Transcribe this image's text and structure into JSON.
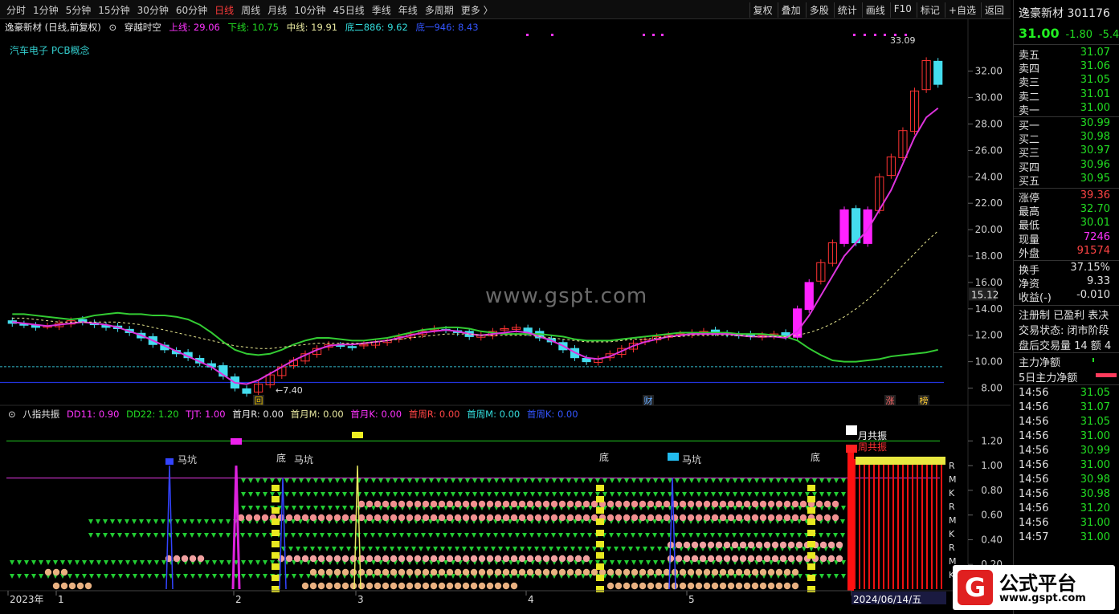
{
  "toolbar": {
    "timeframes": [
      "分时",
      "1分钟",
      "5分钟",
      "15分钟",
      "30分钟",
      "60分钟",
      "日线",
      "周线",
      "月线",
      "10分钟",
      "45日线",
      "季线",
      "年线",
      "多周期",
      "更多 〉"
    ],
    "active_timeframe": "日线",
    "tools": [
      "复权",
      "叠加",
      "多股",
      "统计",
      "画线",
      "F10",
      "标记",
      "+自选",
      "返回"
    ]
  },
  "main_info": {
    "title": "逸豪新材 (日线,前复权)",
    "indicator": "穿越时空",
    "upper": "上线: 29.06",
    "lower": "下线: 10.75",
    "middle": "中线: 19.91",
    "bottom2": "底二886: 9.62",
    "bottom3": "底一946: 8.43"
  },
  "sector": "汽车电子 PCB概念",
  "watermark": "www.gspt.com",
  "price_axis": [
    "32.00",
    "30.00",
    "28.00",
    "26.00",
    "24.00",
    "22.00",
    "20.00",
    "18.00",
    "16.00",
    "14.00",
    "12.00",
    "10.00",
    "8.00"
  ],
  "price_marker": "15.12",
  "annotations": {
    "high": "33.09",
    "low": "←7.40",
    "marks": [
      "回",
      "财",
      "涨",
      "榜"
    ]
  },
  "sub_info": {
    "name": "八指共振",
    "dd11": "DD11: 0.90",
    "dd22": "DD22: 1.20",
    "tjt": "TJT: 1.00",
    "first_month_r": "首月R: 0.00",
    "first_month_m": "首月M: 0.00",
    "first_month_k": "首月K: 0.00",
    "first_week_r": "首周R: 0.00",
    "first_week_m": "首周M: 0.00",
    "first_week_k": "首周K: 0.00"
  },
  "sub_axis": [
    "1.20",
    "1.00",
    "0.80",
    "0.60",
    "0.40",
    "0.20"
  ],
  "sub_labels": [
    "马坑",
    "底",
    "马坑",
    "底",
    "马坑",
    "底",
    "月共振",
    "周共振"
  ],
  "row_labels": [
    "R",
    "M",
    "K",
    "R",
    "M",
    "K",
    "R",
    "M",
    "K"
  ],
  "x_axis": [
    "2023年",
    "1",
    "2",
    "3",
    "4",
    "5",
    "2024/06/14/五"
  ],
  "side": {
    "name": "逸豪新材",
    "code": "301176",
    "price": "31.00",
    "change": "-1.80",
    "pct": "-5.4",
    "asks": [
      {
        "k": "卖五",
        "v": "31.07"
      },
      {
        "k": "卖四",
        "v": "31.06"
      },
      {
        "k": "卖三",
        "v": "31.05"
      },
      {
        "k": "卖二",
        "v": "31.01"
      },
      {
        "k": "卖一",
        "v": "31.00"
      }
    ],
    "bids": [
      {
        "k": "买一",
        "v": "30.99"
      },
      {
        "k": "买二",
        "v": "30.98"
      },
      {
        "k": "买三",
        "v": "30.97"
      },
      {
        "k": "买四",
        "v": "30.96"
      },
      {
        "k": "买五",
        "v": "30.95"
      }
    ],
    "stats1": [
      {
        "k": "涨停",
        "v": "39.36",
        "c": "#ff4444"
      },
      {
        "k": "最高",
        "v": "32.70",
        "c": "#22dd22"
      },
      {
        "k": "最低",
        "v": "30.01",
        "c": "#22dd22"
      },
      {
        "k": "现量",
        "v": "7246",
        "c": "#ff33ff"
      },
      {
        "k": "外盘",
        "v": "91574",
        "c": "#ff4444"
      }
    ],
    "stats2": [
      {
        "k": "换手",
        "v": "37.15%",
        "c": "#e0e0e0"
      },
      {
        "k": "净资",
        "v": "9.33",
        "c": "#e0e0e0"
      },
      {
        "k": "收益(-)",
        "v": "-0.010",
        "c": "#e0e0e0"
      }
    ],
    "status": [
      "注册制 已盈利 表决",
      "交易状态: 闭市阶段",
      "盘后交易量 14 额 4"
    ],
    "flow": [
      "主力净额",
      "5日主力净额"
    ],
    "ticks": [
      {
        "t": "14:56",
        "v": "31.05"
      },
      {
        "t": "14:56",
        "v": "31.07"
      },
      {
        "t": "14:56",
        "v": "31.05"
      },
      {
        "t": "14:56",
        "v": "31.00"
      },
      {
        "t": "14:56",
        "v": "30.99"
      },
      {
        "t": "14:56",
        "v": "31.00"
      },
      {
        "t": "14:56",
        "v": "30.98"
      },
      {
        "t": "14:56",
        "v": "30.98"
      },
      {
        "t": "14:56",
        "v": "31.20"
      },
      {
        "t": "14:56",
        "v": "31.00"
      },
      {
        "t": "14:57",
        "v": "31.00"
      }
    ]
  },
  "logo": {
    "text": "公式平台",
    "url": "www.gspt.com"
  },
  "chart_data": {
    "type": "line",
    "title": "逸豪新材 (日线,前复权)",
    "ylim": [
      7,
      33.5
    ],
    "y_ticks": [
      8,
      10,
      12,
      14,
      16,
      18,
      20,
      22,
      24,
      26,
      28,
      30,
      32
    ],
    "x_tick_labels": [
      "2023年",
      "1",
      "2",
      "3",
      "4",
      "5",
      "2024/06/14/五"
    ],
    "close": [
      12.9,
      12.8,
      12.6,
      12.7,
      12.9,
      13.1,
      13.0,
      12.8,
      12.6,
      12.5,
      12.2,
      11.8,
      11.3,
      10.9,
      10.6,
      10.3,
      9.9,
      9.6,
      8.9,
      8.0,
      7.6,
      8.3,
      9.0,
      9.6,
      10.1,
      10.6,
      11.0,
      11.3,
      11.2,
      11.1,
      11.3,
      11.5,
      11.6,
      11.9,
      12.1,
      12.3,
      12.5,
      12.4,
      12.2,
      11.9,
      12.0,
      12.3,
      12.5,
      12.6,
      12.2,
      11.8,
      11.5,
      10.9,
      10.3,
      10.0,
      10.2,
      10.6,
      11.0,
      11.4,
      11.7,
      11.9,
      12.0,
      12.1,
      12.2,
      12.3,
      12.2,
      12.1,
      12.0,
      11.9,
      12.0,
      12.1,
      11.9,
      14.0,
      16.0,
      17.5,
      19.0,
      21.5,
      19.0,
      21.5,
      24.0,
      25.5,
      27.5,
      30.5,
      32.8,
      31.0
    ],
    "series": [
      {
        "name": "上线",
        "values": [
          13.6,
          13.6,
          13.5,
          13.4,
          13.3,
          13.2,
          13.3,
          13.5,
          13.6,
          13.7,
          13.6,
          13.6,
          13.5,
          13.5,
          13.4,
          13.2,
          12.8,
          12.2,
          11.5,
          10.9,
          10.6,
          10.5,
          10.6,
          10.9,
          11.3,
          11.6,
          11.8,
          11.8,
          11.7,
          11.6,
          11.6,
          11.7,
          11.8,
          12.0,
          12.2,
          12.4,
          12.5,
          12.6,
          12.6,
          12.5,
          12.3,
          12.2,
          12.1,
          12.1,
          12.1,
          12.1,
          12.0,
          11.9,
          11.7,
          11.6,
          11.6,
          11.6,
          11.7,
          11.8,
          11.9,
          12.0,
          12.1,
          12.2,
          12.2,
          12.2,
          12.2,
          12.2,
          12.1,
          12.1,
          12.1,
          12.0,
          11.9,
          11.6,
          11.0,
          10.5,
          10.1,
          10.0,
          10.0,
          10.1,
          10.2,
          10.4,
          10.5,
          10.6,
          10.7,
          10.9
        ]
      },
      {
        "name": "下线",
        "values": [
          13.0,
          12.9,
          12.8,
          12.7,
          12.8,
          12.9,
          13.0,
          12.9,
          12.8,
          12.6,
          12.3,
          12.0,
          11.6,
          11.2,
          10.8,
          10.4,
          10.0,
          9.6,
          9.0,
          8.4,
          8.3,
          8.6,
          9.1,
          9.6,
          10.1,
          10.5,
          10.9,
          11.2,
          11.3,
          11.3,
          11.4,
          11.5,
          11.6,
          11.8,
          12.0,
          12.2,
          12.3,
          12.4,
          12.3,
          12.1,
          12.0,
          12.1,
          12.2,
          12.3,
          12.2,
          11.9,
          11.6,
          11.2,
          10.7,
          10.3,
          10.2,
          10.4,
          10.8,
          11.2,
          11.5,
          11.7,
          11.9,
          12.0,
          12.1,
          12.1,
          12.1,
          12.1,
          12.0,
          11.9,
          11.9,
          11.9,
          11.8,
          12.3,
          13.5,
          15.0,
          16.5,
          18.0,
          19.0,
          20.0,
          21.5,
          23.0,
          25.0,
          27.0,
          28.5,
          29.2
        ]
      },
      {
        "name": "中线",
        "values": [
          13.3,
          13.3,
          13.2,
          13.1,
          13.0,
          13.0,
          13.0,
          13.0,
          13.0,
          13.0,
          12.9,
          12.8,
          12.6,
          12.4,
          12.2,
          12.0,
          11.8,
          11.6,
          11.4,
          11.2,
          11.1,
          11.0,
          11.0,
          11.1,
          11.2,
          11.3,
          11.4,
          11.4,
          11.4,
          11.4,
          11.4,
          11.5,
          11.6,
          11.7,
          11.8,
          11.9,
          12.0,
          12.1,
          12.1,
          12.1,
          12.0,
          12.0,
          12.0,
          12.0,
          12.0,
          11.9,
          11.8,
          11.7,
          11.6,
          11.5,
          11.5,
          11.5,
          11.6,
          11.7,
          11.7,
          11.8,
          11.9,
          11.9,
          12.0,
          12.0,
          12.0,
          12.0,
          12.0,
          11.9,
          11.9,
          11.9,
          11.9,
          12.0,
          12.2,
          12.5,
          12.9,
          13.4,
          14.0,
          14.7,
          15.5,
          16.4,
          17.3,
          18.2,
          19.1,
          19.9
        ]
      }
    ],
    "hlines": [
      {
        "name": "底二",
        "value": 9.62
      },
      {
        "name": "底一",
        "value": 8.43
      }
    ]
  }
}
